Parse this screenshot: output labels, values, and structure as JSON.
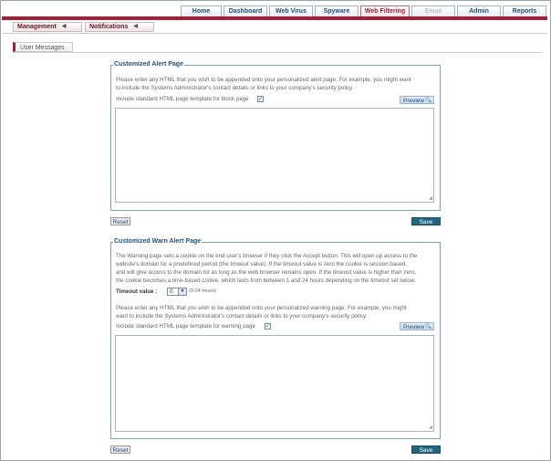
{
  "top_nav": {
    "tabs": [
      {
        "label": "Home"
      },
      {
        "label": "Dashboard"
      },
      {
        "label": "Web Virus"
      },
      {
        "label": "Spyware"
      },
      {
        "label": "Web Filtering"
      },
      {
        "label": "Email"
      },
      {
        "label": "Admin"
      },
      {
        "label": "Reports"
      }
    ],
    "active": "Web Filtering",
    "disabled": "Email"
  },
  "sub_nav": {
    "items": [
      {
        "label": "Management"
      },
      {
        "label": "Notifications"
      }
    ]
  },
  "page_tab": {
    "label": "User Messages"
  },
  "alert_page": {
    "title": "Customized Alert Page",
    "desc_line1": "Please enter any HTML that you wish to be appended onto your personalized alert page. For example, you might want",
    "desc_line2": "to include the Systems Administrator's contact details or links to your company's security policy.",
    "template_label": "Include standard HTML page template for block page",
    "template_checked": true,
    "preview_label": "Preview",
    "reset_label": "Reset",
    "save_label": "Save"
  },
  "warn_page": {
    "title": "Customized Warn Alert Page",
    "desc_lines": [
      "The Warning page sets a cookie on the end user's browser if they click the Accept button. This will open up access to the",
      "website's domain for a predefined period (the timeout value). If the timeout value is zero the cookie is session based,",
      "and will give access to the domain for as long as the web browser remains open. If the timeout value is higher than zero,",
      "the cookie becomes a time-based cookie, which lasts from between 1 and 24 hours depending on the timeout set below."
    ],
    "timeout_label": "Timeout value :",
    "timeout_value": "0",
    "timeout_hint": "(0-24 hours)",
    "html_line1": "Please enter any HTML that you wish to be appended onto your personalized warning page. For example, you might",
    "html_line2": "want to include the Systems Administrator's contact details or links to your company's security policy.",
    "template_label": "Include standard HTML page template for warning page",
    "template_checked": true,
    "preview_label": "Preview",
    "reset_label": "Reset",
    "save_label": "Save"
  }
}
